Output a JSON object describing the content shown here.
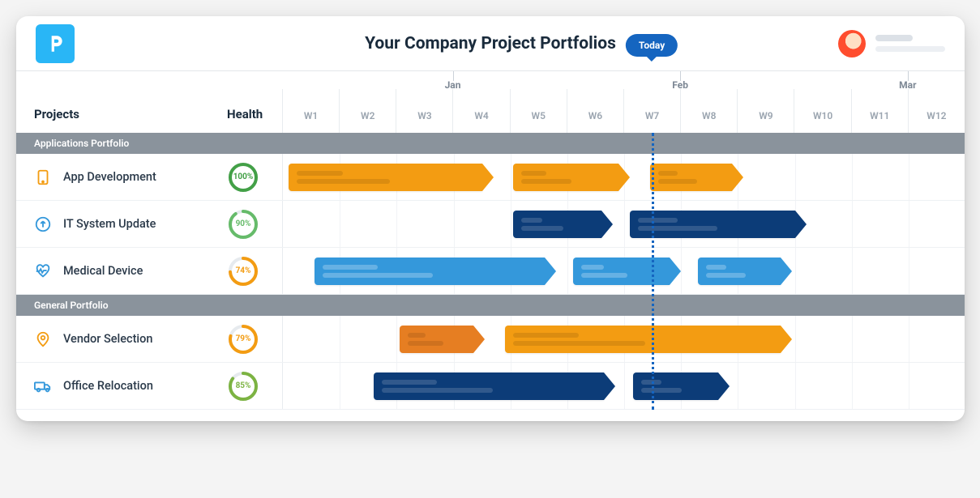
{
  "header": {
    "title": "Your Company Project Portfolios",
    "logo_letter": "P"
  },
  "columns": {
    "projects_label": "Projects",
    "health_label": "Health"
  },
  "timeline": {
    "weeks": [
      "W1",
      "W2",
      "W3",
      "W4",
      "W5",
      "W6",
      "W7",
      "W8",
      "W9",
      "W10",
      "W11",
      "W12"
    ],
    "months": [
      {
        "label": "Jan",
        "at_week_boundary": 3
      },
      {
        "label": "Feb",
        "at_week_boundary": 7
      },
      {
        "label": "Mar",
        "at_week_boundary": 11
      }
    ],
    "today": {
      "label": "Today",
      "position_week": 6.5
    }
  },
  "groups": [
    {
      "name": "Applications Portfolio",
      "projects": [
        {
          "name": "App Development",
          "icon": "tablet-icon",
          "icon_color": "#f39c12",
          "health_pct": 100,
          "health_color": "#43a047",
          "bars": [
            {
              "start": 0.1,
              "end": 3.7,
              "color": "orange"
            },
            {
              "start": 4.05,
              "end": 6.1,
              "color": "orange"
            },
            {
              "start": 6.45,
              "end": 8.1,
              "color": "orange"
            }
          ]
        },
        {
          "name": "IT System Update",
          "icon": "arrow-up-circle-icon",
          "icon_color": "#3498db",
          "health_pct": 90,
          "health_color": "#66bb6a",
          "bars": [
            {
              "start": 4.05,
              "end": 5.8,
              "color": "navy"
            },
            {
              "start": 6.1,
              "end": 9.2,
              "color": "navy"
            }
          ]
        },
        {
          "name": "Medical Device",
          "icon": "heartbeat-icon",
          "icon_color": "#3498db",
          "health_pct": 74,
          "health_color": "#f39c12",
          "bars": [
            {
              "start": 0.55,
              "end": 4.8,
              "color": "sky"
            },
            {
              "start": 5.1,
              "end": 7.0,
              "color": "sky"
            },
            {
              "start": 7.3,
              "end": 8.95,
              "color": "sky"
            }
          ]
        }
      ]
    },
    {
      "name": "General Portfolio",
      "projects": [
        {
          "name": "Vendor Selection",
          "icon": "map-pin-icon",
          "icon_color": "#f39c12",
          "health_pct": 79,
          "health_color": "#f39c12",
          "bars": [
            {
              "start": 2.05,
              "end": 3.55,
              "color": "dkorange"
            },
            {
              "start": 3.9,
              "end": 8.95,
              "color": "orange"
            }
          ]
        },
        {
          "name": "Office Relocation",
          "icon": "truck-icon",
          "icon_color": "#3498db",
          "health_pct": 85,
          "health_color": "#7cb342",
          "bars": [
            {
              "start": 1.6,
              "end": 5.85,
              "color": "navy"
            },
            {
              "start": 6.15,
              "end": 7.85,
              "color": "navy"
            }
          ]
        }
      ]
    }
  ],
  "chart_data": {
    "type": "gantt",
    "x_unit": "week",
    "x_range": [
      0,
      12
    ],
    "x_ticks": [
      "W1",
      "W2",
      "W3",
      "W4",
      "W5",
      "W6",
      "W7",
      "W8",
      "W9",
      "W10",
      "W11",
      "W12"
    ],
    "month_boundaries": {
      "Jan": 3,
      "Feb": 7,
      "Mar": 11
    },
    "today_marker": 6.5,
    "series": [
      {
        "name": "App Development",
        "group": "Applications Portfolio",
        "health_pct": 100,
        "segments": [
          [
            0.1,
            3.7
          ],
          [
            4.05,
            6.1
          ],
          [
            6.45,
            8.1
          ]
        ],
        "color": "#f39c12"
      },
      {
        "name": "IT System Update",
        "group": "Applications Portfolio",
        "health_pct": 90,
        "segments": [
          [
            4.05,
            5.8
          ],
          [
            6.1,
            9.2
          ]
        ],
        "color": "#0c3c78"
      },
      {
        "name": "Medical Device",
        "group": "Applications Portfolio",
        "health_pct": 74,
        "segments": [
          [
            0.55,
            4.8
          ],
          [
            5.1,
            7.0
          ],
          [
            7.3,
            8.95
          ]
        ],
        "color": "#3498db"
      },
      {
        "name": "Vendor Selection",
        "group": "General Portfolio",
        "health_pct": 79,
        "segments": [
          [
            2.05,
            3.55
          ],
          [
            3.9,
            8.95
          ]
        ],
        "color": "#f39c12"
      },
      {
        "name": "Office Relocation",
        "group": "General Portfolio",
        "health_pct": 85,
        "segments": [
          [
            1.6,
            5.85
          ],
          [
            6.15,
            7.85
          ]
        ],
        "color": "#0c3c78"
      }
    ]
  }
}
